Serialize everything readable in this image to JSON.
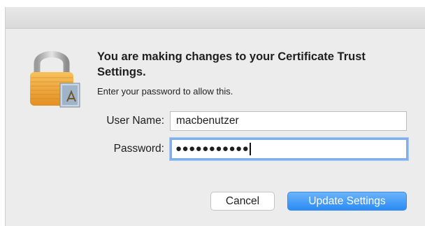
{
  "dialog": {
    "title": "You are making changes to your Certificate Trust Settings.",
    "subtitle": "Enter your password to allow this.",
    "icon": "padlock-with-certificate-icon"
  },
  "form": {
    "username_label": "User Name:",
    "username_value": "macbenutzer",
    "password_label": "Password:",
    "password_masked": "●●●●●●●●●●●"
  },
  "buttons": {
    "cancel_label": "Cancel",
    "update_label": "Update Settings"
  },
  "colors": {
    "accent": "#2a8cf5",
    "focus_ring": "#7fb0ea",
    "lock_gold": "#f0a43a"
  }
}
